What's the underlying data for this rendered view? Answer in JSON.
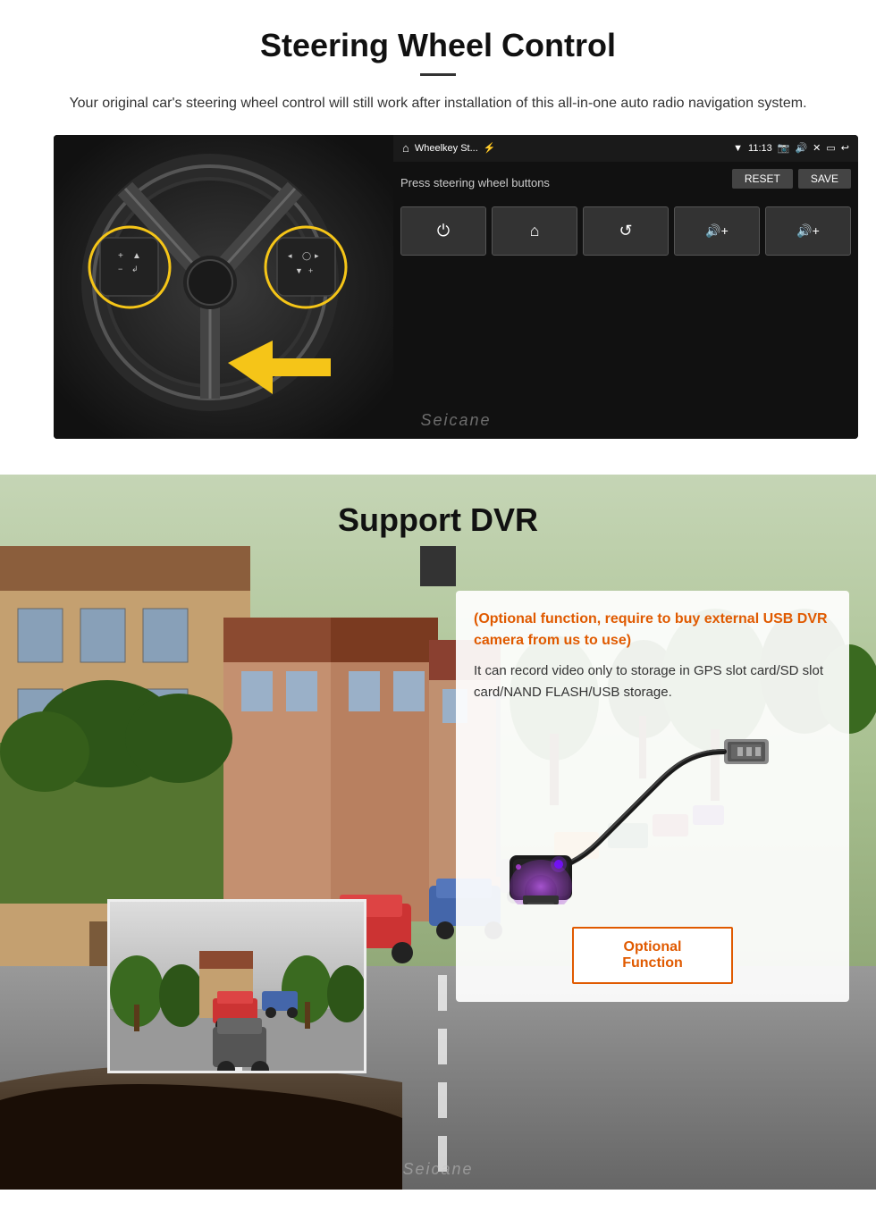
{
  "section1": {
    "title": "Steering Wheel Control",
    "subtitle": "Your original car's steering wheel control will still work after installation of this all-in-one auto radio navigation system.",
    "android_screen": {
      "app_title": "Wheelkey St...",
      "time": "11:13",
      "press_label": "Press steering wheel buttons",
      "reset_btn": "RESET",
      "save_btn": "SAVE",
      "keys": [
        "⏻",
        "⌂",
        "↺",
        "🔊+",
        "🔊+"
      ]
    },
    "watermark": "Seicane"
  },
  "section2": {
    "title": "Support DVR",
    "optional_notice": "(Optional function, require to buy external USB DVR camera from us to use)",
    "description": "It can record video only to storage in GPS slot card/SD slot card/NAND FLASH/USB storage.",
    "optional_function_label": "Optional Function",
    "watermark": "Seicane"
  }
}
